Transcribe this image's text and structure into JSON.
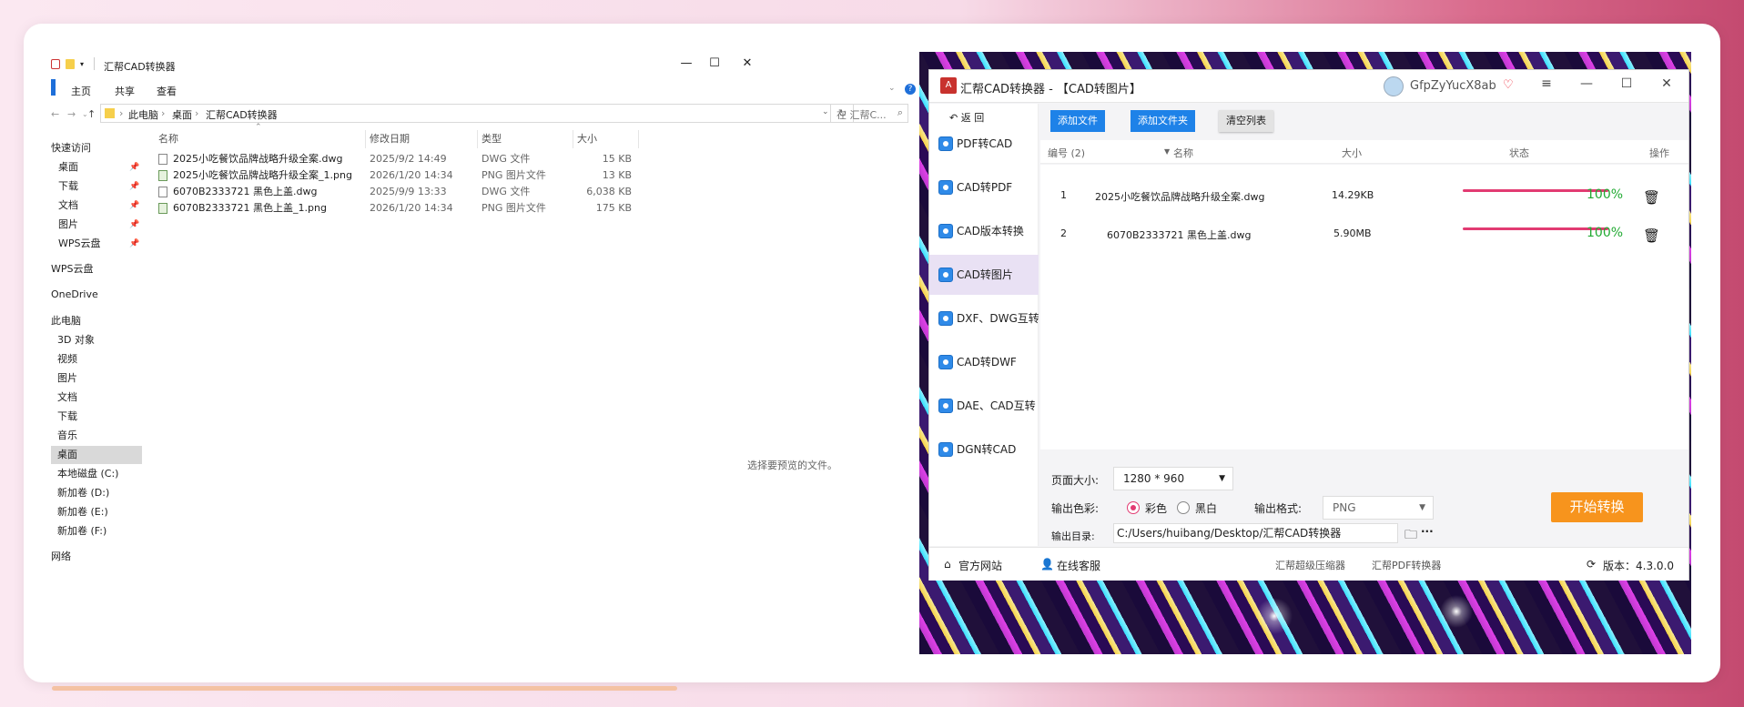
{
  "explorer": {
    "title": "汇帮CAD转换器",
    "controls": {
      "minimize": "—",
      "maximize": "☐",
      "close": "✕"
    },
    "ribbon": [
      "主页",
      "共享",
      "查看"
    ],
    "address": {
      "segments": [
        "此电脑",
        "桌面",
        "汇帮CAD转换器"
      ],
      "search_placeholder": "在 汇帮C..."
    },
    "nav": [
      {
        "label": "快速访问"
      },
      {
        "label": "桌面",
        "pinned": true
      },
      {
        "label": "下载",
        "pinned": true
      },
      {
        "label": "文档",
        "pinned": true
      },
      {
        "label": "图片",
        "pinned": true
      },
      {
        "label": "WPS云盘",
        "pinned": true
      },
      {
        "label": "WPS云盘"
      },
      {
        "label": "OneDrive"
      },
      {
        "label": "此电脑"
      },
      {
        "label": "3D 对象"
      },
      {
        "label": "视频"
      },
      {
        "label": "图片"
      },
      {
        "label": "文档"
      },
      {
        "label": "下载"
      },
      {
        "label": "音乐"
      },
      {
        "label": "桌面",
        "selected": true
      },
      {
        "label": "本地磁盘 (C:)"
      },
      {
        "label": "新加卷 (D:)"
      },
      {
        "label": "新加卷 (E:)"
      },
      {
        "label": "新加卷 (F:)"
      },
      {
        "label": "网络"
      }
    ],
    "columns": {
      "name": "名称",
      "modified": "修改日期",
      "type": "类型",
      "size": "大小"
    },
    "files": [
      {
        "name": "2025小吃餐饮品牌战略升级全案.dwg",
        "modified": "2025/9/2 14:49",
        "type": "DWG 文件",
        "size": "15 KB",
        "icon": "file-icon"
      },
      {
        "name": "2025小吃餐饮品牌战略升级全案_1.png",
        "modified": "2026/1/20 14:34",
        "type": "PNG 图片文件",
        "size": "13 KB",
        "icon": "image-file-icon"
      },
      {
        "name": "6070B2333721 黑色上盖.dwg",
        "modified": "2025/9/9 13:33",
        "type": "DWG 文件",
        "size": "6,038 KB",
        "icon": "file-icon"
      },
      {
        "name": "6070B2333721 黑色上盖_1.png",
        "modified": "2026/1/20 14:34",
        "type": "PNG 图片文件",
        "size": "175 KB",
        "icon": "image-file-icon"
      }
    ],
    "preview_hint": "选择要预览的文件。"
  },
  "app": {
    "title": "汇帮CAD转换器 - 【CAD转图片】",
    "username": "GfpZyYucX8ab",
    "back_label": "返 回",
    "sidebar": [
      "PDF转CAD",
      "CAD转PDF",
      "CAD版本转换",
      "CAD转图片",
      "DXF、DWG互转",
      "CAD转DWF",
      "DAE、CAD互转",
      "DGN转CAD"
    ],
    "selected_sidebar_index": 3,
    "toolbar": {
      "add_file": "添加文件",
      "add_folder": "添加文件夹",
      "clear_list": "清空列表"
    },
    "table": {
      "headers": {
        "index": "编号 (2)",
        "name": "名称",
        "size": "大小",
        "status": "状态",
        "action": "操作"
      },
      "rows": [
        {
          "index": "1",
          "name": "2025小吃餐饮品牌战略升级全案.dwg",
          "size": "14.29KB",
          "progress_pct": 100,
          "progress": "100%"
        },
        {
          "index": "2",
          "name": "6070B2333721 黑色上盖.dwg",
          "size": "5.90MB",
          "progress_pct": 100,
          "progress": "100%"
        }
      ]
    },
    "options": {
      "page_size_label": "页面大小:",
      "page_size": "1280 * 960",
      "color_label": "输出色彩:",
      "color_options": [
        "彩色",
        "黑白"
      ],
      "selected_color": "彩色",
      "format_label": "输出格式:",
      "format": "PNG",
      "dir_label": "输出目录:",
      "dir": "C:/Users/huibang/Desktop/汇帮CAD转换器",
      "more": "···",
      "start_label": "开始转换"
    },
    "footer": {
      "website": "官方网站",
      "support": "在线客服",
      "link1": "汇帮超级压缩器",
      "link2": "汇帮PDF转换器",
      "version": "版本：4.3.0.0"
    },
    "colors": {
      "primary": "#1e82e8",
      "accent": "#e23b72",
      "start": "#f7941d",
      "success": "#22aa33"
    }
  }
}
